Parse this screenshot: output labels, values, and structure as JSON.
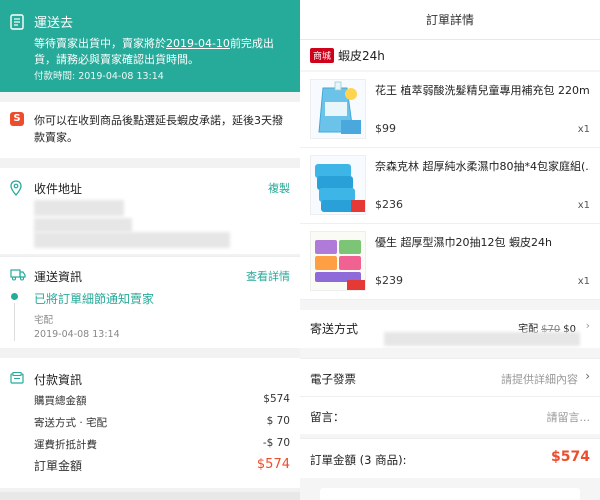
{
  "left": {
    "shipping_banner": {
      "title": "運送去",
      "message_prefix": "等待賣家出貨中，賣家將於",
      "message_date": "2019-04-10",
      "message_suffix": "前完成出貨，請務必與賣家確認出貨時間。",
      "paid_time": "付款時間: 2019-04-08 13:14"
    },
    "notice": {
      "icon": "shopee-guarantee-icon",
      "text": "你可以在收到商品後點選延長蝦皮承諾，延後3天撥款賣家。"
    },
    "address": {
      "label": "收件地址",
      "copy_label": "複製"
    },
    "tracking": {
      "label": "運送資訊",
      "more_label": "查看詳情",
      "status": "已將訂單細節通知賣家",
      "carrier": "宅配",
      "time": "2019-04-08 13:14"
    },
    "payment": {
      "label": "付款資訊",
      "rows": [
        {
          "label": "購買總金額",
          "value": "$574"
        },
        {
          "label": "寄送方式 · 宅配",
          "value": "$ 70"
        },
        {
          "label": "運費折抵計費",
          "value": "-$ 70"
        }
      ],
      "total_label": "訂單金額",
      "total_value": "$574"
    }
  },
  "right": {
    "header_title": "訂單詳情",
    "shop": {
      "tag": "商城",
      "name": "蝦皮24h"
    },
    "items": [
      {
        "name": "花王 植萃弱酸洗髮精兒童專用補充包 220m...",
        "price": "$99",
        "qty": "x1"
      },
      {
        "name": "奈森克林 超厚純水柔濕巾80抽*4包家庭組(...",
        "price": "$236",
        "qty": "x1"
      },
      {
        "name": "優生 超厚型濕巾20抽12包 蝦皮24h",
        "price": "$239",
        "qty": "x1"
      }
    ],
    "shipping": {
      "label": "寄送方式",
      "method": "宅配",
      "original": "$70",
      "price": "$0"
    },
    "invoice": {
      "label": "電子發票",
      "value": "請提供詳細內容"
    },
    "note": {
      "label": "留言：",
      "placeholder": "請留言..."
    },
    "total": {
      "label": "訂單金額 (3 商品):",
      "value": "$574"
    }
  },
  "colors": {
    "teal": "#26aa99",
    "orange": "#ee4d2d",
    "mall_red": "#d0011b"
  }
}
